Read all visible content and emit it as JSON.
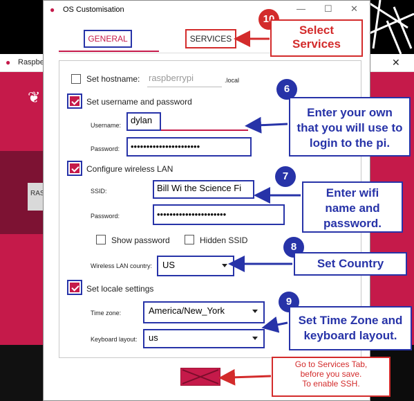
{
  "background_window": {
    "title": "Raspberry Pi Imager v1.7.2",
    "title_visible": "Raspbe",
    "button_text": "RAS"
  },
  "dialog": {
    "title": "OS Customisation",
    "tabs": [
      {
        "label": "GENERAL"
      },
      {
        "label": "SERVICES"
      }
    ],
    "hostname": {
      "label": "Set hostname:",
      "value": "raspberrypi",
      "suffix": ".local",
      "checked": false
    },
    "user": {
      "label": "Set username and password",
      "checked": true,
      "username_label": "Username:",
      "username": "dylan",
      "password_label": "Password:",
      "password": "••••••••••••••••••••••"
    },
    "wifi": {
      "label": "Configure wireless LAN",
      "checked": true,
      "ssid_label": "SSID:",
      "ssid": "Bill Wi the Science Fi",
      "password_label": "Password:",
      "password": "••••••••••••••••••••••",
      "show_password": "Show password",
      "hidden_ssid": "Hidden SSID",
      "country_label": "Wireless LAN country:",
      "country": "US"
    },
    "locale": {
      "label": "Set locale settings",
      "checked": true,
      "timezone_label": "Time zone:",
      "timezone": "America/New_York",
      "keyboard_label": "Keyboard layout:",
      "keyboard": "us"
    }
  },
  "annotations": {
    "step10": {
      "number": "10",
      "text1": "Select",
      "text2": "Services"
    },
    "step6": {
      "number": "6",
      "line1": "Enter your own",
      "line2": "that you will use to",
      "line3": "login to the pi."
    },
    "step7": {
      "number": "7",
      "line1": "Enter wifi",
      "line2": "name and",
      "line3": "password."
    },
    "step8": {
      "number": "8",
      "text": "Set Country"
    },
    "step9": {
      "number": "9",
      "line1": "Set Time Zone and",
      "line2": "keyboard layout."
    },
    "note": {
      "line1": "Go to Services Tab,",
      "line2": "before you save.",
      "line3": "To enable SSH."
    }
  },
  "colors": {
    "accent": "#c51a4a",
    "annotation_blue": "#2733a8",
    "annotation_red": "#d32b2b"
  }
}
